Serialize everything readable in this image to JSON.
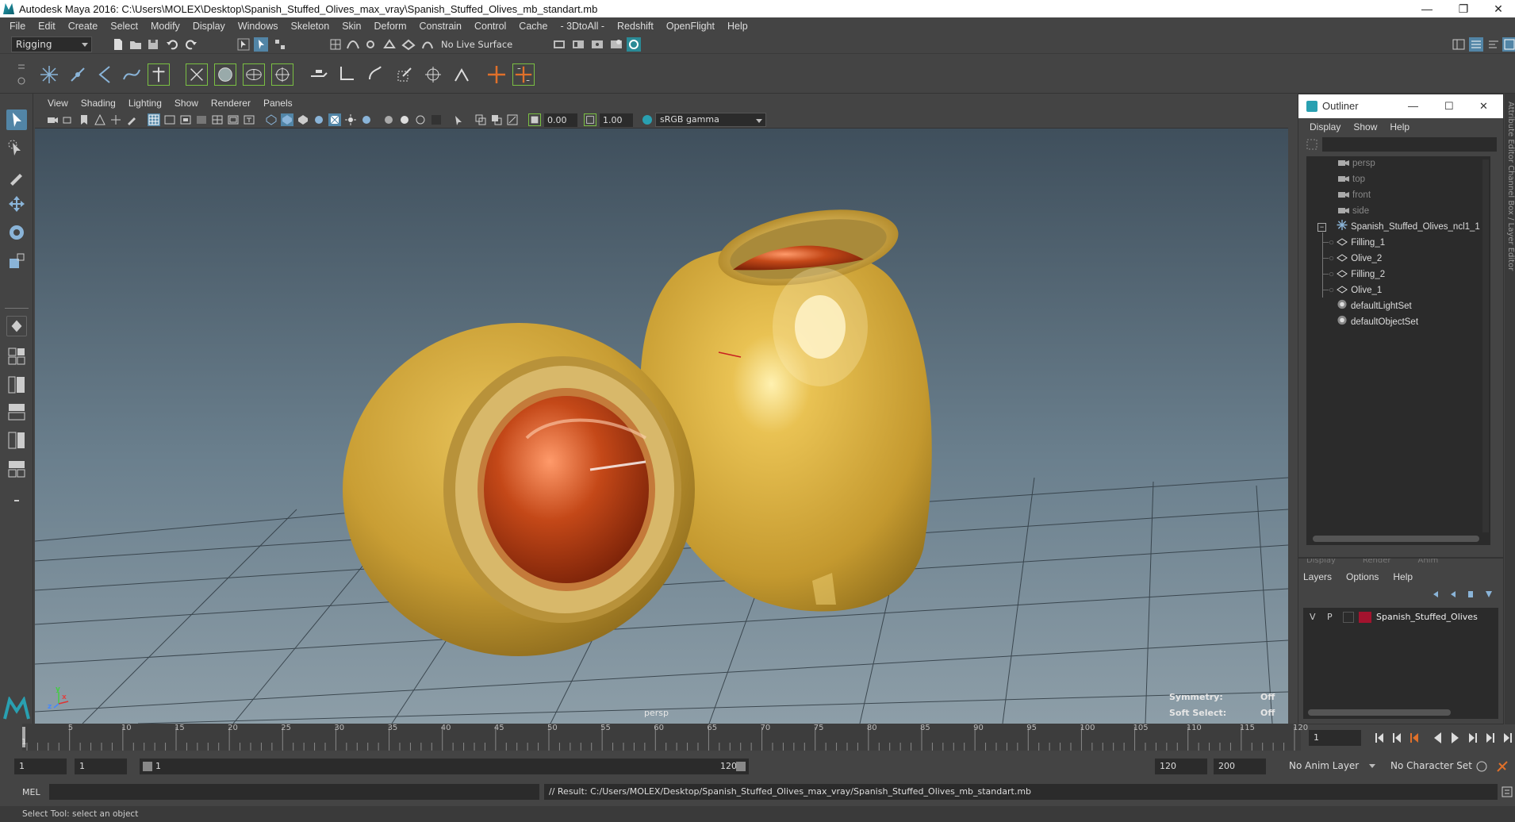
{
  "window": {
    "title": "Autodesk Maya 2016: C:\\Users\\MOLEX\\Desktop\\Spanish_Stuffed_Olives_max_vray\\Spanish_Stuffed_Olives_mb_standart.mb",
    "minimize": "—",
    "restore": "❐",
    "close": "✕"
  },
  "menubar": [
    "File",
    "Edit",
    "Create",
    "Select",
    "Modify",
    "Display",
    "Windows",
    "Skeleton",
    "Skin",
    "Deform",
    "Constrain",
    "Control",
    "Cache",
    "- 3DtoAll -",
    "Redshift",
    "OpenFlight",
    "Help"
  ],
  "statusline": {
    "mode": "Rigging",
    "live_surface": "No Live Surface"
  },
  "viewport": {
    "menu": [
      "View",
      "Shading",
      "Lighting",
      "Show",
      "Renderer",
      "Panels"
    ],
    "exposure": "0.00",
    "gamma": "1.00",
    "color_space": "sRGB gamma",
    "camera_label": "persp",
    "hud": {
      "symmetry_label": "Symmetry:",
      "symmetry_value": "Off",
      "soft_select_label": "Soft Select:",
      "soft_select_value": "Off"
    },
    "axis": {
      "x": "x",
      "y": "y",
      "z": "z"
    }
  },
  "outliner": {
    "title": "Outliner",
    "menu": [
      "Display",
      "Show",
      "Help"
    ],
    "items": [
      {
        "label": "persp",
        "type": "camera",
        "dim": true
      },
      {
        "label": "top",
        "type": "camera",
        "dim": true
      },
      {
        "label": "front",
        "type": "camera",
        "dim": true
      },
      {
        "label": "side",
        "type": "camera",
        "dim": true
      },
      {
        "label": "Spanish_Stuffed_Olives_ncl1_1",
        "type": "group",
        "dim": false
      },
      {
        "label": "Filling_1",
        "type": "mesh",
        "dim": false
      },
      {
        "label": "Olive_2",
        "type": "mesh",
        "dim": false
      },
      {
        "label": "Filling_2",
        "type": "mesh",
        "dim": false
      },
      {
        "label": "Olive_1",
        "type": "mesh",
        "dim": false
      },
      {
        "label": "defaultLightSet",
        "type": "set",
        "dim": false
      },
      {
        "label": "defaultObjectSet",
        "type": "set",
        "dim": false
      }
    ],
    "side_tabs": "Attribute Editor   Channel Box / Layer Editor"
  },
  "layer_editor": {
    "tabs": [
      "Display",
      "Render",
      "Anim"
    ],
    "menu": [
      "Layers",
      "Options",
      "Help"
    ],
    "layer": {
      "v": "V",
      "p": "P",
      "name": "Spanish_Stuffed_Olives",
      "color": "#a3132e"
    }
  },
  "timeline": {
    "ticks": [
      "5",
      "10",
      "15",
      "20",
      "25",
      "30",
      "35",
      "40",
      "45",
      "50",
      "55",
      "60",
      "65",
      "70",
      "75",
      "80",
      "85",
      "90",
      "95",
      "100",
      "105",
      "110",
      "115",
      "120"
    ],
    "start_tick": "1",
    "current_frame": "1"
  },
  "range": {
    "start": "1",
    "anim_start": "1",
    "slider_start": "1",
    "slider_end": "120",
    "anim_end": "120",
    "end": "200",
    "anim_layer": "No Anim Layer",
    "character_set": "No Character Set"
  },
  "command": {
    "lang": "MEL",
    "result": "// Result: C:/Users/MOLEX/Desktop/Spanish_Stuffed_Olives_max_vray/Spanish_Stuffed_Olives_mb_standart.mb"
  },
  "helpline": "Select Tool: select an object",
  "colors": {
    "accent": "#29a0b1",
    "olive": "#c9a23b",
    "filling": "#c0451a",
    "layer_color": "#a3132e"
  }
}
